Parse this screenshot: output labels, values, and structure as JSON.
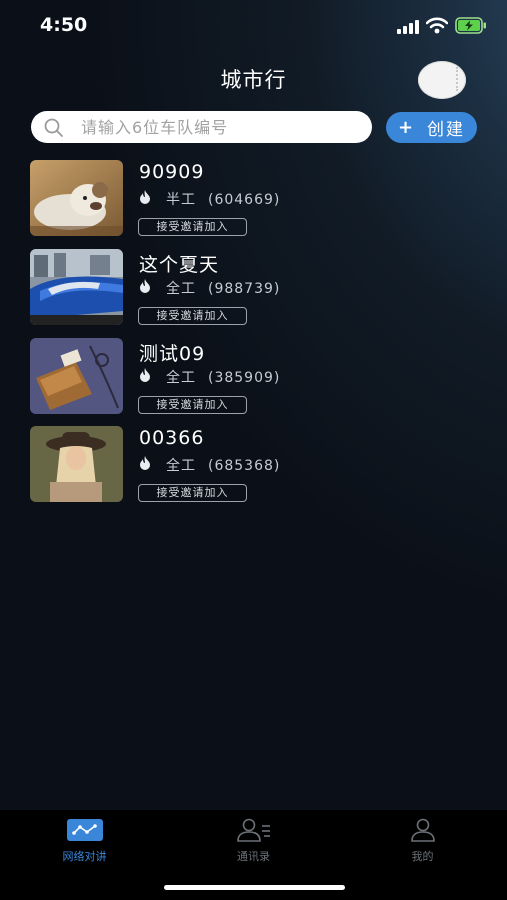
{
  "status_bar": {
    "time": "4:50"
  },
  "header": {
    "title": "城市行"
  },
  "search": {
    "placeholder": "请输入6位车队编号",
    "value": ""
  },
  "create_button": {
    "icon": "+",
    "label": "创建"
  },
  "teams": [
    {
      "name": "90909",
      "type": "半工",
      "code": "(604669)",
      "action": "接受邀请加入",
      "thumb": "teddy-bear-photo"
    },
    {
      "name": "这个夏天",
      "type": "全工",
      "code": "(988739)",
      "action": "接受邀请加入",
      "thumb": "blue-car-photo"
    },
    {
      "name": "测试09",
      "type": "全工",
      "code": "(385909)",
      "action": "接受邀请加入",
      "thumb": "leather-bag-photo"
    },
    {
      "name": "00366",
      "type": "全工",
      "code": "(685368)",
      "action": "接受邀请加入",
      "thumb": "woman-hat-photo"
    }
  ],
  "tabs": [
    {
      "label": "网络对讲",
      "icon": "network-intercom-icon",
      "active": true
    },
    {
      "label": "通讯录",
      "icon": "contacts-icon",
      "active": false
    },
    {
      "label": "我的",
      "icon": "profile-icon",
      "active": false
    }
  ],
  "colors": {
    "accent": "#3a86d8",
    "background": "#111b26",
    "tab_bar": "#000000"
  }
}
